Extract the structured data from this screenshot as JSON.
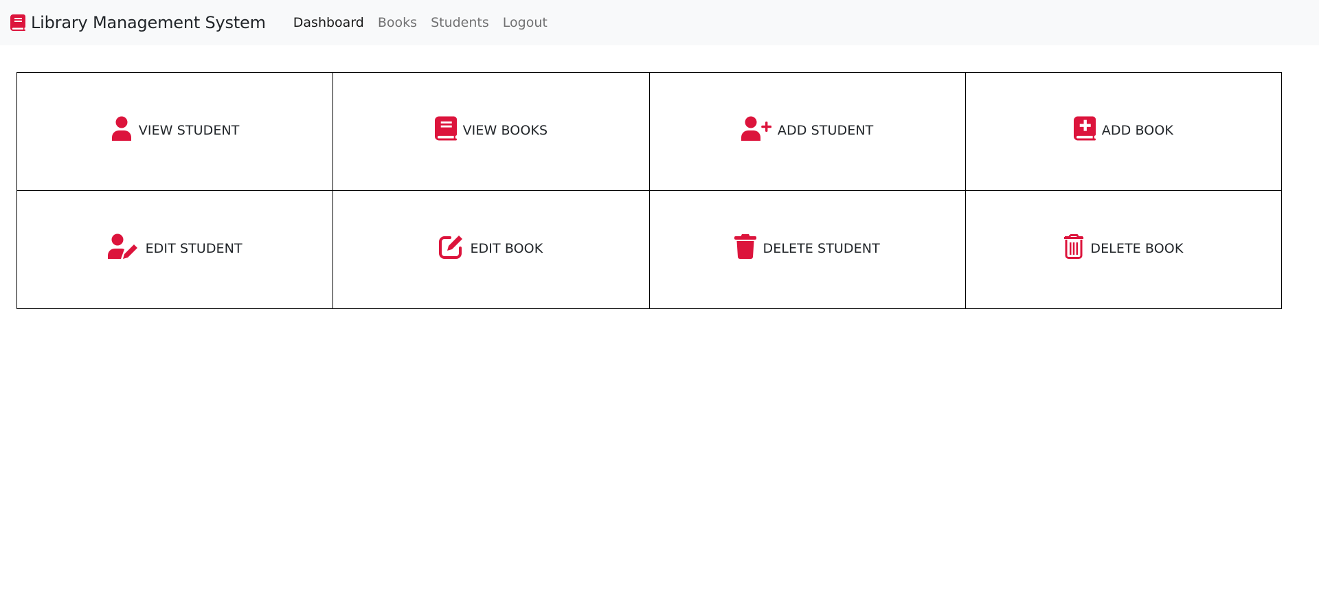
{
  "app": {
    "brand_title": "Library Management System",
    "brand_icon": "book-icon",
    "accent_color": "#dc143c"
  },
  "nav": {
    "items": [
      {
        "label": "Dashboard",
        "active": true
      },
      {
        "label": "Books",
        "active": false
      },
      {
        "label": "Students",
        "active": false
      },
      {
        "label": "Logout",
        "active": false
      }
    ]
  },
  "dashboard": {
    "tiles": [
      {
        "label": "VIEW STUDENT",
        "icon": "user-icon"
      },
      {
        "label": "VIEW BOOKS",
        "icon": "book-icon"
      },
      {
        "label": "ADD STUDENT",
        "icon": "user-plus-icon"
      },
      {
        "label": "ADD BOOK",
        "icon": "book-medical-icon"
      },
      {
        "label": "EDIT STUDENT",
        "icon": "user-pen-icon"
      },
      {
        "label": "EDIT BOOK",
        "icon": "pen-to-square-icon"
      },
      {
        "label": "DELETE STUDENT",
        "icon": "trash-icon"
      },
      {
        "label": "DELETE BOOK",
        "icon": "trash-can-outline-icon"
      }
    ]
  }
}
